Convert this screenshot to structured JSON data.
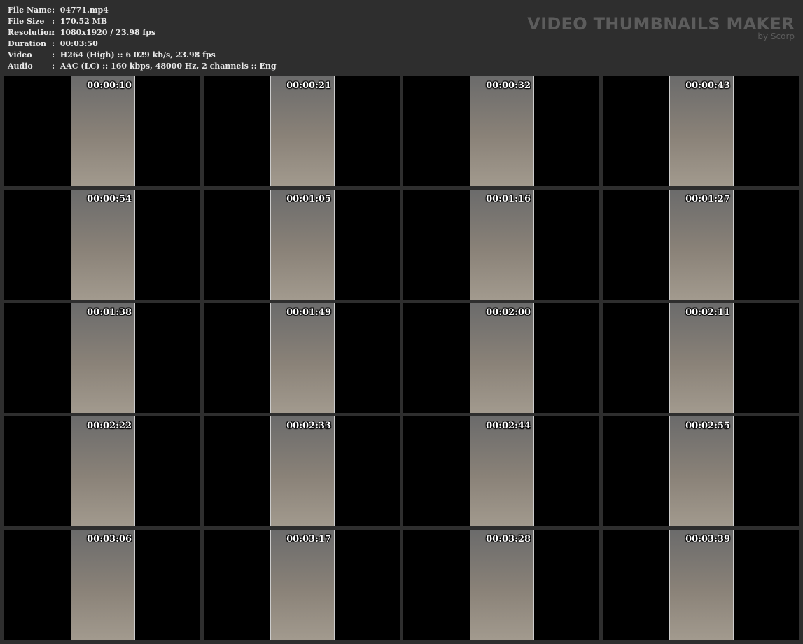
{
  "info": [
    {
      "label": "File Name",
      "value": ":  04771.mp4"
    },
    {
      "label": "File Size",
      "value": ":  170.52 MB"
    },
    {
      "label": "Resolution",
      "value": ":  1080x1920 / 23.98 fps"
    },
    {
      "label": "Duration",
      "value": ":  00:03:50"
    },
    {
      "label": "Video",
      "value": ":  H264 (High) :: 6 029 kb/s, 23.98 fps"
    },
    {
      "label": "Audio",
      "value": ":  AAC (LC) :: 160 kbps, 48000 Hz, 2 channels :: Eng"
    }
  ],
  "logo": {
    "title": "VIDEO THUMBNAILS MAKER",
    "byline": "by Scorp"
  },
  "timestamps": [
    "00:00:10",
    "00:00:21",
    "00:00:32",
    "00:00:43",
    "00:00:54",
    "00:01:05",
    "00:01:16",
    "00:01:27",
    "00:01:38",
    "00:01:49",
    "00:02:00",
    "00:02:11",
    "00:02:22",
    "00:02:33",
    "00:02:44",
    "00:02:55",
    "00:03:06",
    "00:03:17",
    "00:03:28",
    "00:03:39"
  ]
}
